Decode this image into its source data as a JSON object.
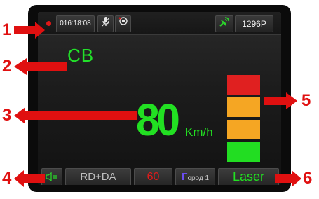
{
  "top_bar": {
    "clock": "016:18:08",
    "counter": "1296P",
    "icons": [
      "record-dot-icon",
      "microphone-icon",
      "voice-record-icon",
      "satellite-icon"
    ]
  },
  "band": "CB",
  "speed": {
    "value": "80",
    "unit": "Km/h"
  },
  "signal_level": {
    "segments_lit": 4,
    "segments_total": 4,
    "colors_top_to_bottom": [
      "#e02020",
      "#f5a623",
      "#f5a623",
      "#22dd22"
    ]
  },
  "bottom_bar": {
    "mode": "RD+DA",
    "limit": "60",
    "city_prefix": "Г",
    "city_rest": "ород 1",
    "detector": "Laser"
  },
  "callouts": [
    "1",
    "2",
    "3",
    "4",
    "5",
    "6"
  ],
  "colors": {
    "callout": "#e01010",
    "accent": "#22e022",
    "limit": "#e21a1a"
  }
}
